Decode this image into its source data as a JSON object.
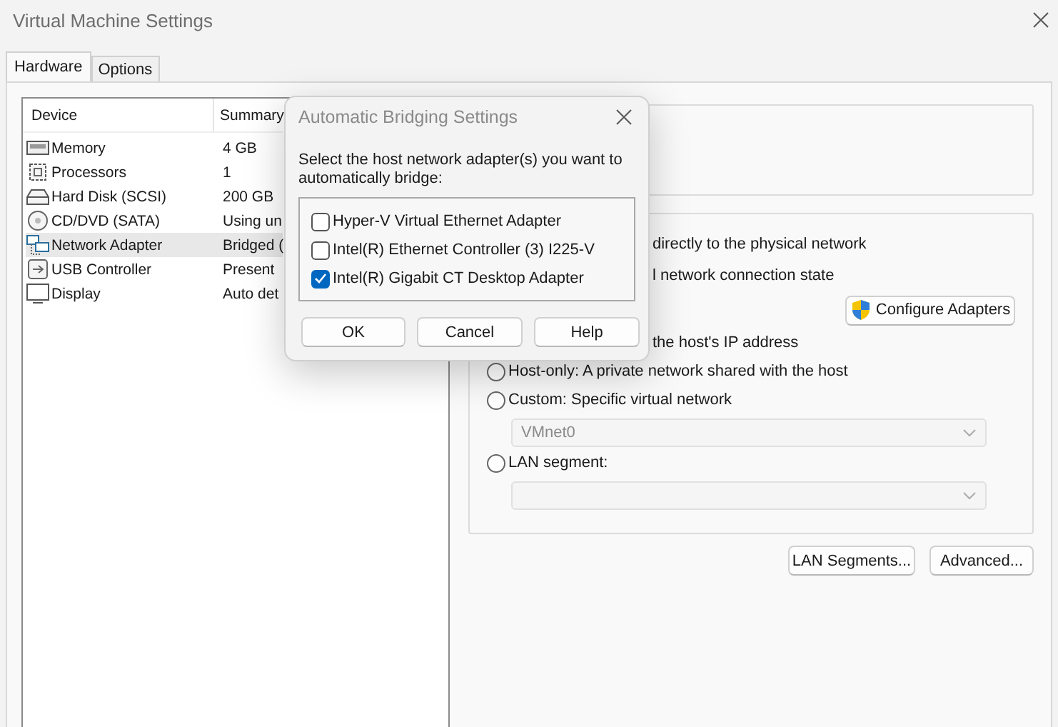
{
  "window": {
    "title": "Virtual Machine Settings"
  },
  "tabs": [
    {
      "label": "Hardware",
      "selected": true
    },
    {
      "label": "Options",
      "selected": false
    }
  ],
  "devices": {
    "columns": [
      "Device",
      "Summary"
    ],
    "rows": [
      {
        "kind": "memory",
        "device": "Memory",
        "summary": "4 GB",
        "selected": false
      },
      {
        "kind": "processor",
        "device": "Processors",
        "summary": "1",
        "selected": false
      },
      {
        "kind": "disk",
        "device": "Hard Disk (SCSI)",
        "summary": "200 GB",
        "selected": false
      },
      {
        "kind": "cd",
        "device": "CD/DVD (SATA)",
        "summary": "Using un",
        "selected": false
      },
      {
        "kind": "network",
        "device": "Network Adapter",
        "summary": "Bridged (",
        "selected": true
      },
      {
        "kind": "usb",
        "device": "USB Controller",
        "summary": "Present",
        "selected": false
      },
      {
        "kind": "display",
        "device": "Display",
        "summary": "Auto det",
        "selected": false
      }
    ]
  },
  "connection": {
    "fragments": [
      "directly to the physical network",
      "l network connection state"
    ],
    "configure_button": "Configure Adapters",
    "nat_fragment": "the host's IP address",
    "options": [
      {
        "label": "Host-only: A private network shared with the host",
        "selected": false
      },
      {
        "label": "Custom: Specific virtual network",
        "selected": false
      },
      {
        "label": "LAN segment:",
        "selected": false
      }
    ],
    "custom_network": {
      "value": "VMnet0",
      "disabled": true
    },
    "lan_segment_combo": {
      "disabled": true
    }
  },
  "buttons": [
    "LAN Segments...",
    "Advanced..."
  ],
  "dialog": {
    "title": "Automatic Bridging Settings",
    "prompt": "Select the host network adapter(s) you want to automatically bridge:",
    "adapters": [
      {
        "label": "Hyper-V Virtual Ethernet Adapter",
        "checked": false
      },
      {
        "label": "Intel(R) Ethernet Controller (3) I225-V",
        "checked": false
      },
      {
        "label": "Intel(R) Gigabit CT Desktop Adapter",
        "checked": true
      }
    ],
    "buttons": [
      "OK",
      "Cancel",
      "Help"
    ]
  }
}
